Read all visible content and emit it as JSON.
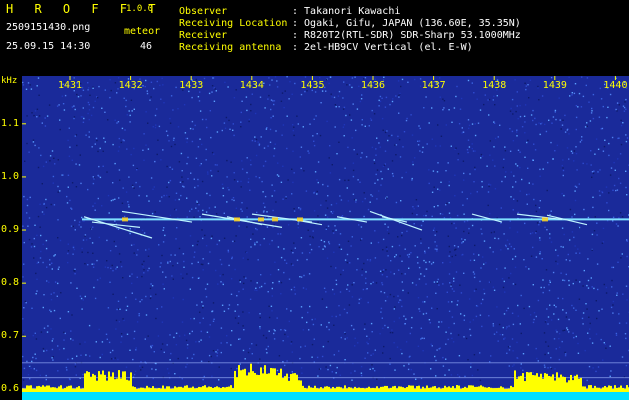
{
  "header": {
    "brand": "H R O F F T",
    "version": "1.0.0",
    "filename": "2509151430.png",
    "datetime": "25.09.15 14:30",
    "meteor_label": "meteor",
    "meteor_count": "46",
    "fields": [
      {
        "label": "Observer",
        "value": ": Takanori Kawachi"
      },
      {
        "label": "Receiving Location",
        "value": ": Ogaki, Gifu, JAPAN (136.60E, 35.35N)"
      },
      {
        "label": "Receiver",
        "value": ": R820T2(RTL-SDR) SDR-Sharp 53.1000MHz"
      },
      {
        "label": "Receiving antenna",
        "value": ": 2el-HB9CV Vertical (el. E-W)"
      }
    ]
  },
  "chart_data": {
    "type": "heatmap",
    "ylabel": "kHz",
    "x_ticks": [
      "1431",
      "1432",
      "1433",
      "1434",
      "1435",
      "1436",
      "1437",
      "1438",
      "1439",
      "1440"
    ],
    "y_ticks": [
      "1.1",
      "1.0",
      "0.9",
      "0.8",
      "0.7",
      "0.6"
    ],
    "ylim": [
      0.58,
      1.19
    ],
    "carrier_khz": 0.92,
    "colors": {
      "background": "#1a2a9a",
      "carrier": "#7fe0ff",
      "activity": "#ffff00",
      "baseline": "#00e0ff"
    }
  }
}
